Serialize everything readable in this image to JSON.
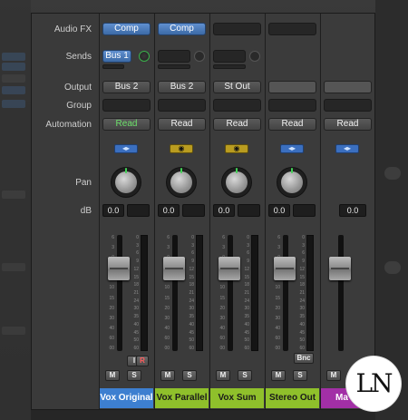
{
  "row_labels": {
    "audio_fx": "Audio FX",
    "sends": "Sends",
    "output": "Output",
    "group": "Group",
    "automation": "Automation",
    "pan": "Pan",
    "db": "dB"
  },
  "fader_scale": [
    "6",
    "3",
    "0",
    "3",
    "6",
    "10",
    "15",
    "20",
    "30",
    "40",
    "60"
  ],
  "fader_scale_extra": "00",
  "meter_scale": [
    "0",
    "3",
    "6",
    "9",
    "12",
    "15",
    "18",
    "21",
    "24",
    "30",
    "35",
    "40",
    "45",
    "50",
    "60"
  ],
  "channels": [
    {
      "name": "Vox Original",
      "color": "#3d7fd0",
      "audio_fx": "Comp",
      "send": "Bus 1",
      "output": "Bus 2",
      "automation": "Read",
      "automation_active": true,
      "indicator": "blue",
      "db": "0.0",
      "level": 0.62,
      "has_ir": true,
      "input_label": "I",
      "record_label": "R",
      "mute": "M",
      "solo": "S"
    },
    {
      "name": "Vox Parallel",
      "color": "#8fc02b",
      "audio_fx": "Comp",
      "send": "",
      "output": "Bus 2",
      "automation": "Read",
      "automation_active": false,
      "indicator": "yellow",
      "db": "0.0",
      "level": 0.62,
      "mute": "M",
      "solo": "S"
    },
    {
      "name": "Vox Sum",
      "color": "#8fc02b",
      "audio_fx": "",
      "send": "",
      "output": "St Out",
      "automation": "Read",
      "automation_active": false,
      "indicator": "yellow",
      "db": "0.0",
      "level": 0.62,
      "mute": "M",
      "solo": "S"
    },
    {
      "name": "Stereo Out",
      "color": "#8fc02b",
      "audio_fx": "",
      "send": "",
      "output": "",
      "automation": "Read",
      "automation_active": false,
      "indicator": "blue",
      "db": "0.0",
      "level": 0.62,
      "has_bnc": true,
      "bnc_label": "Bnc",
      "mute": "M",
      "solo": "S"
    },
    {
      "name": "Ma",
      "color": "#a22fa6",
      "audio_fx": "",
      "send": "",
      "output": "",
      "automation": "Read",
      "automation_active": false,
      "indicator": "blue",
      "db": "0.0",
      "level": 0.62,
      "mute": "M",
      "solo": "S"
    }
  ],
  "logo_text": "LN"
}
